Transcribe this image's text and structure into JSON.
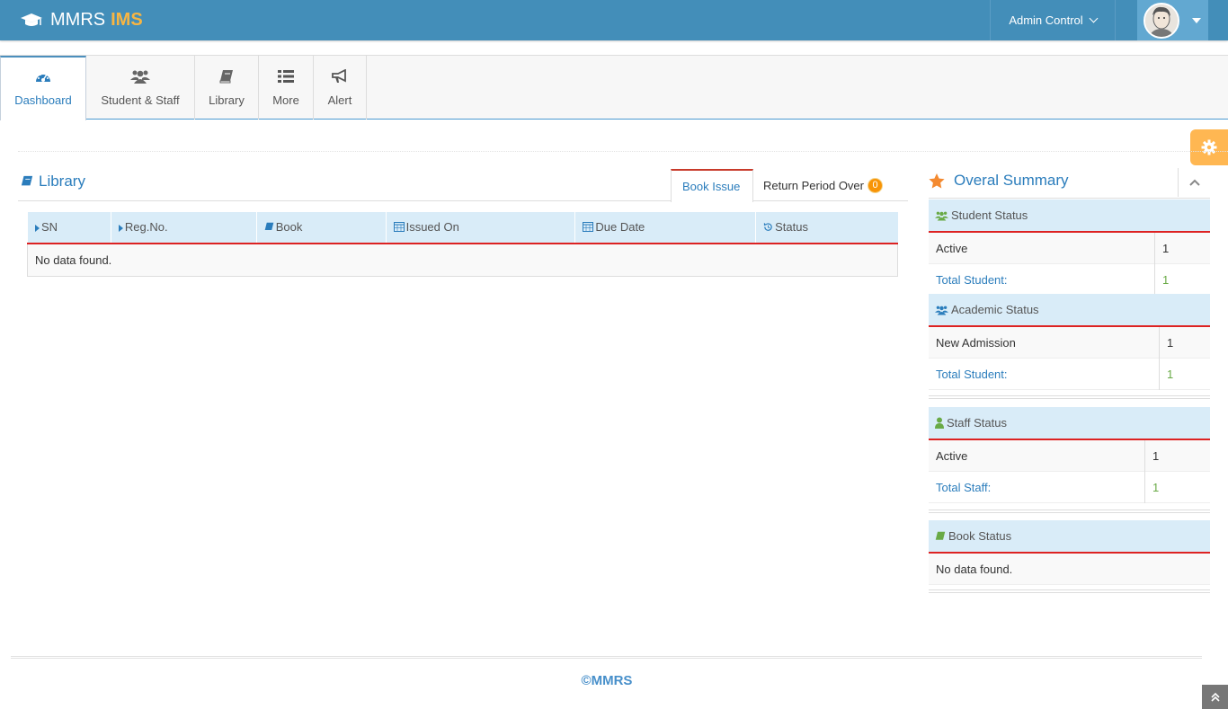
{
  "brand": {
    "name": "MMRS",
    "suffix": "IMS"
  },
  "header": {
    "admin_label": "Admin Control"
  },
  "tabs": [
    {
      "label": "Dashboard",
      "icon": "dashboard-icon"
    },
    {
      "label": "Student & Staff",
      "icon": "users-icon"
    },
    {
      "label": "Library",
      "icon": "book-icon"
    },
    {
      "label": "More",
      "icon": "list-icon"
    },
    {
      "label": "Alert",
      "icon": "bullhorn-icon"
    }
  ],
  "library": {
    "title": "Library",
    "tab_book_issue": "Book Issue",
    "tab_return_over": "Return Period Over",
    "return_over_count": "0",
    "columns": [
      "SN",
      "Reg.No.",
      "Book",
      "Issued On",
      "Due Date",
      "Status"
    ],
    "empty": "No data found."
  },
  "summary": {
    "title": "Overal Summary",
    "student": {
      "heading": "Student Status",
      "active_label": "Active",
      "active_value": "1",
      "total_label": "Total Student:",
      "total_value": "1"
    },
    "academic": {
      "heading": "Academic Status",
      "new_label": "New Admission",
      "new_value": "1",
      "total_label": "Total Student:",
      "total_value": "1"
    },
    "staff": {
      "heading": "Staff Status",
      "active_label": "Active",
      "active_value": "1",
      "total_label": "Total Staff:",
      "total_value": "1"
    },
    "book": {
      "heading": "Book Status",
      "empty": "No data found."
    }
  },
  "footer": {
    "text": "©MMRS"
  },
  "colors": {
    "navbar": "#438eb9",
    "accent": "#2b7dbc",
    "brand_highlight": "#f7b543",
    "header_rule": "#dd2222",
    "badge": "#f89406",
    "settings": "#ffb752"
  }
}
